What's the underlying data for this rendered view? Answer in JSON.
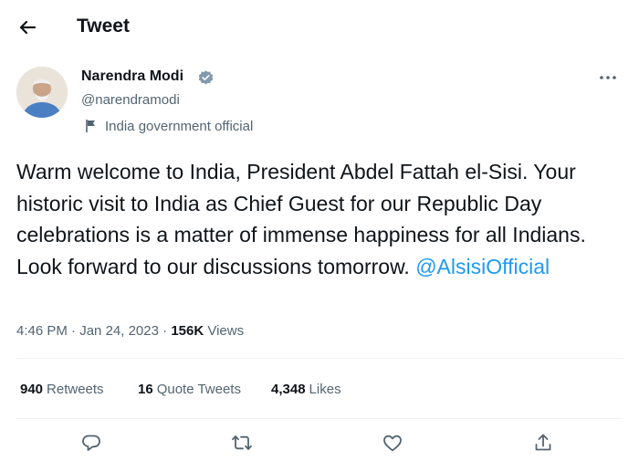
{
  "header": {
    "title": "Tweet",
    "back_icon": "arrow-left-icon"
  },
  "author": {
    "name": "Narendra Modi",
    "handle": "@narendramodi",
    "verified_icon": "verified-badge-icon",
    "label": "India government official",
    "label_icon": "flag-icon"
  },
  "more_icon": "more-horizontal-icon",
  "tweet": {
    "text": "Warm welcome to India, President Abdel Fattah el-Sisi. Your historic visit to India as Chief Guest for our Republic Day celebrations is a matter of immense happiness for all Indians. Look forward to our discussions tomorrow.",
    "mention": "@AlsisiOfficial"
  },
  "meta": {
    "time": "4:46 PM",
    "separator1": "·",
    "date": "Jan 24, 2023",
    "separator2": "·",
    "views_count": "156K",
    "views_label": "Views"
  },
  "stats": {
    "retweets_count": "940",
    "retweets_label": "Retweets",
    "quotes_count": "16",
    "quotes_label": "Quote Tweets",
    "likes_count": "4,348",
    "likes_label": "Likes"
  },
  "actions": [
    "reply-icon",
    "retweet-icon",
    "like-icon",
    "share-icon"
  ],
  "colors": {
    "accent": "#1d9bf0",
    "text": "#0f1419",
    "muted": "#536471",
    "divider": "#eff3f4"
  }
}
